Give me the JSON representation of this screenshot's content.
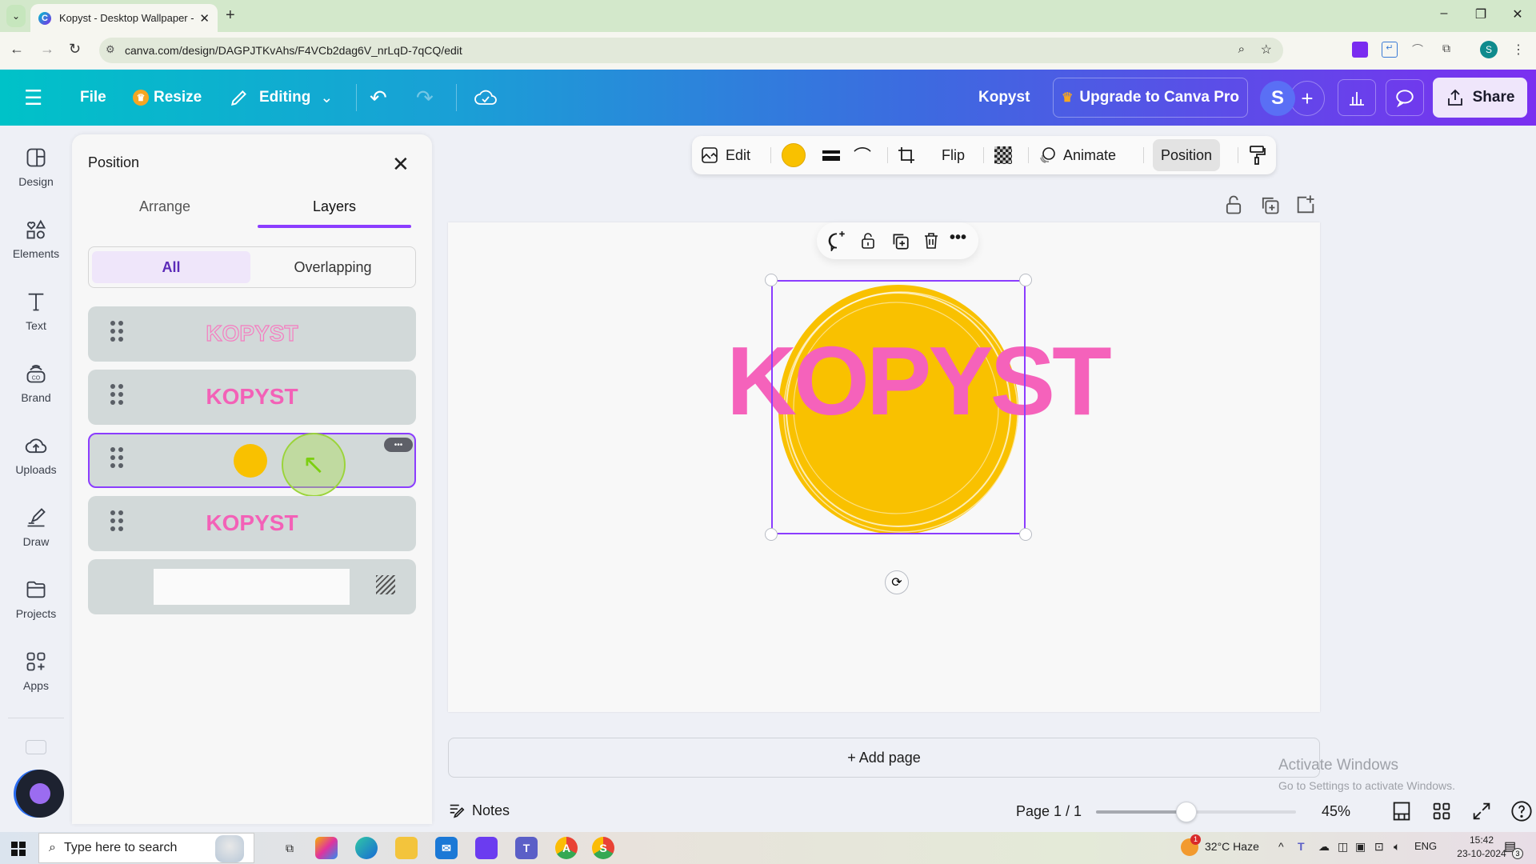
{
  "browser": {
    "tab_title": "Kopyst - Desktop Wallpaper - C",
    "url": "canva.com/design/DAGPJTKvAhs/F4VCb2dag6V_nrLqD-7qCQ/edit",
    "profile_initial": "S",
    "new_tab_symbol": "+",
    "window_controls": {
      "minimize": "–",
      "restore": "❐",
      "close": "✕"
    }
  },
  "header": {
    "file_label": "File",
    "resize_label": "Resize",
    "editing_label": "Editing",
    "doc_title": "Kopyst",
    "upgrade_label": "Upgrade to Canva Pro",
    "avatar_initial": "S",
    "share_label": "Share"
  },
  "rail": {
    "items": [
      {
        "label": "Design",
        "icon": "design-icon"
      },
      {
        "label": "Elements",
        "icon": "elements-icon"
      },
      {
        "label": "Text",
        "icon": "text-icon"
      },
      {
        "label": "Brand",
        "icon": "brand-icon"
      },
      {
        "label": "Uploads",
        "icon": "uploads-icon"
      },
      {
        "label": "Draw",
        "icon": "draw-icon"
      },
      {
        "label": "Projects",
        "icon": "projects-icon"
      },
      {
        "label": "Apps",
        "icon": "apps-icon"
      }
    ]
  },
  "panel": {
    "title": "Position",
    "tabs": [
      {
        "label": "Arrange",
        "active": false
      },
      {
        "label": "Layers",
        "active": true
      }
    ],
    "filters": [
      {
        "label": "All",
        "active": true
      },
      {
        "label": "Overlapping",
        "active": false
      }
    ],
    "layers": [
      {
        "type": "text-outline",
        "label": "KOPYST",
        "selected": false
      },
      {
        "type": "text",
        "label": "KOPYST",
        "selected": false
      },
      {
        "type": "shape",
        "label": "",
        "selected": true,
        "more_label": "•••"
      },
      {
        "type": "text",
        "label": "KOPYST",
        "selected": false
      },
      {
        "type": "background",
        "label": "",
        "selected": false
      }
    ]
  },
  "toolbar": {
    "edit_label": "Edit",
    "color": "#f9c100",
    "flip_label": "Flip",
    "animate_label": "Animate",
    "position_label": "Position"
  },
  "canvas": {
    "text": "KOPYST",
    "text_color": "#f562bb",
    "shape_color": "#f9c100",
    "selection_color": "#8b3dff",
    "add_page_label": "+ Add page"
  },
  "watermark": {
    "line1": "Activate Windows",
    "line2": "Go to Settings to activate Windows."
  },
  "footer": {
    "notes_label": "Notes",
    "page_indicator": "Page 1 / 1",
    "zoom_percent": "45%",
    "zoom_fraction": 0.45
  },
  "taskbar": {
    "search_placeholder": "Type here to search",
    "weather": "32°C  Haze",
    "weather_badge": "1",
    "language": "ENG",
    "time": "15:42",
    "date": "23-10-2024",
    "notifications": "3"
  }
}
